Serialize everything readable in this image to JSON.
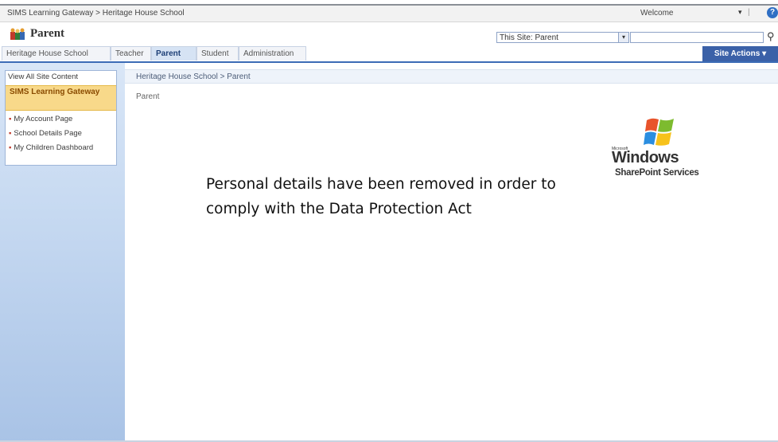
{
  "global": {
    "breadcrumb": "SIMS Learning Gateway > Heritage House School",
    "welcome": "Welcome",
    "welcome_dropdown": "▾",
    "separator": "|",
    "help_icon": "help-icon"
  },
  "site": {
    "title": "Parent",
    "icon": "site-icon"
  },
  "search": {
    "scope": "This Site: Parent",
    "scope_arrow": "▾",
    "placeholder": "",
    "icon": "⚲"
  },
  "tabs": [
    {
      "label": "Heritage House School",
      "active": false
    },
    {
      "label": "Teacher",
      "active": false
    },
    {
      "label": "Parent",
      "active": true
    },
    {
      "label": "Student",
      "active": false
    },
    {
      "label": "Administration",
      "active": false
    }
  ],
  "site_actions": "Site Actions ▾",
  "leftnav": {
    "view_all": "View All Site Content",
    "heading": "SIMS Learning Gateway",
    "items": [
      {
        "label": "My Account Page"
      },
      {
        "label": "School Details Page"
      },
      {
        "label": "My Children Dashboard"
      }
    ]
  },
  "main": {
    "breadcrumb": "Heritage House School > Parent",
    "page_title": "Parent",
    "notice": "Personal details have been removed in order to comply with the Data Protection Act"
  },
  "logo": {
    "microsoft": "Microsoft",
    "windows": "Windows",
    "product": "SharePoint Services"
  },
  "colors": {
    "accent": "#3b61a8",
    "nav_heading_bg": "#f8d98a",
    "nav_bullet": "#c0392b"
  }
}
